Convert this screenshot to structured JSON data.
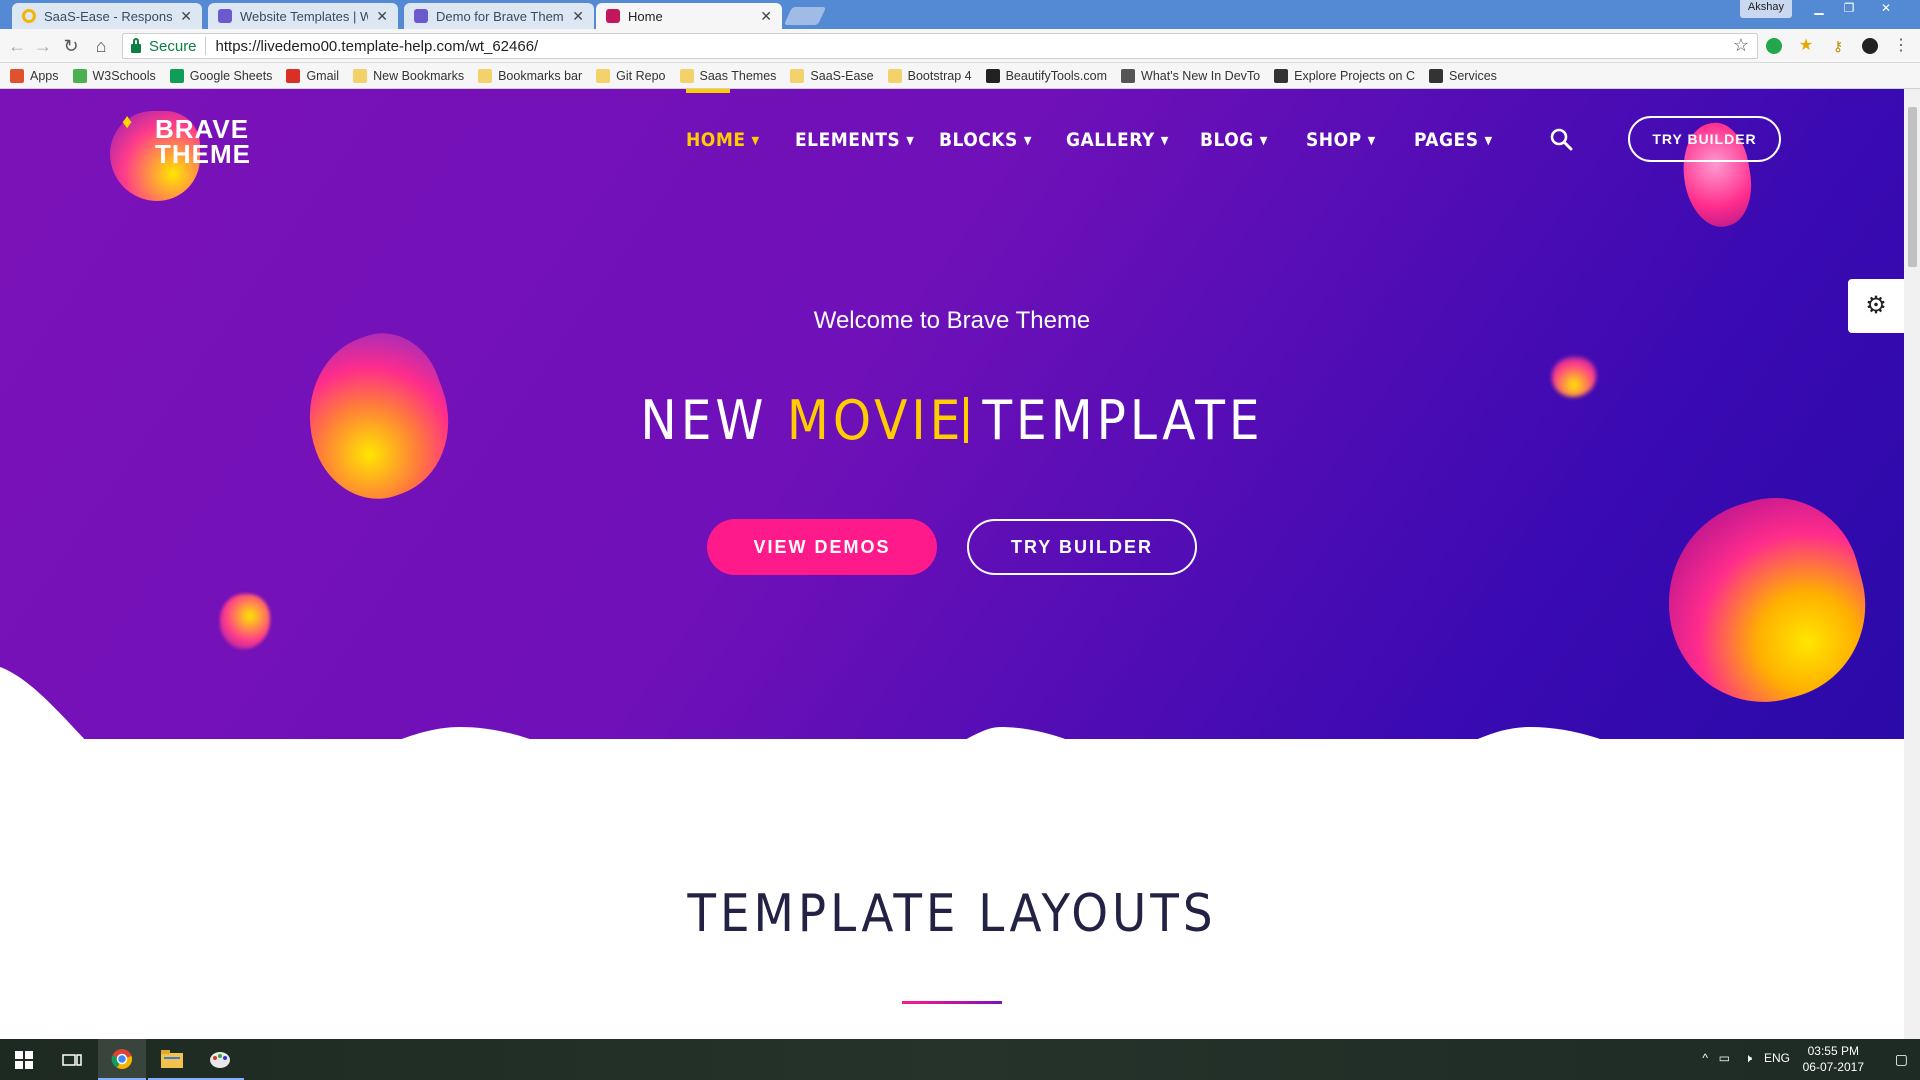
{
  "browser": {
    "tabs": [
      {
        "label": "SaaS-Ease - Responsive S",
        "icon": "saas-favicon-icon",
        "color": "#f4b400"
      },
      {
        "label": "Website Templates | Web",
        "icon": "template-monster-icon",
        "color": "#6a5acd"
      },
      {
        "label": "Demo for Brave Theme -",
        "icon": "template-monster-icon",
        "color": "#6a5acd"
      },
      {
        "label": "Home",
        "icon": "brave-favicon-icon",
        "color": "#c2185b"
      }
    ],
    "user": "Akshay",
    "address": {
      "secure_label": "Secure",
      "url": "https://livedemo00.template-help.com/wt_62466/"
    },
    "bookmarks": [
      {
        "label": "Apps",
        "icon": "apps-grid-icon",
        "color": "#e0522e"
      },
      {
        "label": "W3Schools",
        "icon": "w3schools-icon",
        "color": "#4caf50"
      },
      {
        "label": "Google Sheets",
        "icon": "sheets-icon",
        "color": "#0f9d58"
      },
      {
        "label": "Gmail",
        "icon": "gmail-icon",
        "color": "#d93025"
      },
      {
        "label": "New Bookmarks",
        "icon": "folder-icon",
        "color": "#f3d26b"
      },
      {
        "label": "Bookmarks bar",
        "icon": "folder-icon",
        "color": "#f3d26b"
      },
      {
        "label": "Git Repo",
        "icon": "folder-icon",
        "color": "#f3d26b"
      },
      {
        "label": "Saas Themes",
        "icon": "folder-icon",
        "color": "#f3d26b"
      },
      {
        "label": "SaaS-Ease",
        "icon": "folder-icon",
        "color": "#f3d26b"
      },
      {
        "label": "Bootstrap 4",
        "icon": "folder-icon",
        "color": "#f3d26b"
      },
      {
        "label": "BeautifyTools.com",
        "icon": "bt-icon",
        "color": "#222222"
      },
      {
        "label": "What's New In DevTo",
        "icon": "devtools-icon",
        "color": "#555555"
      },
      {
        "label": "Explore Projects on C",
        "icon": "codepen-icon",
        "color": "#333333"
      },
      {
        "label": "Services",
        "icon": "tumblr-icon",
        "color": "#333333"
      }
    ]
  },
  "site": {
    "logo": {
      "line1": "BRAVE",
      "line2": "THEME"
    },
    "nav": [
      {
        "label": "HOME",
        "active": true
      },
      {
        "label": "ELEMENTS",
        "active": false
      },
      {
        "label": "BLOCKS",
        "active": false
      },
      {
        "label": "GALLERY",
        "active": false
      },
      {
        "label": "BLOG",
        "active": false
      },
      {
        "label": "SHOP",
        "active": false
      },
      {
        "label": "PAGES",
        "active": false
      }
    ],
    "try_builder_nav": "TRY BUILDER",
    "hero": {
      "welcome": "Welcome to Brave Theme",
      "title_part1": "NEW",
      "title_highlight": "MOVIE",
      "title_part2": "TEMPLATE",
      "btn_primary": "VIEW DEMOS",
      "btn_secondary": "TRY BUILDER"
    },
    "section_title": "TEMPLATE LAYOUTS",
    "colors": {
      "accent": "#ffcc00",
      "pink": "#ff1a8c",
      "purple": "#7b12b8"
    }
  },
  "taskbar": {
    "lang": "ENG",
    "time": "03:55 PM",
    "date": "06-07-2017"
  }
}
